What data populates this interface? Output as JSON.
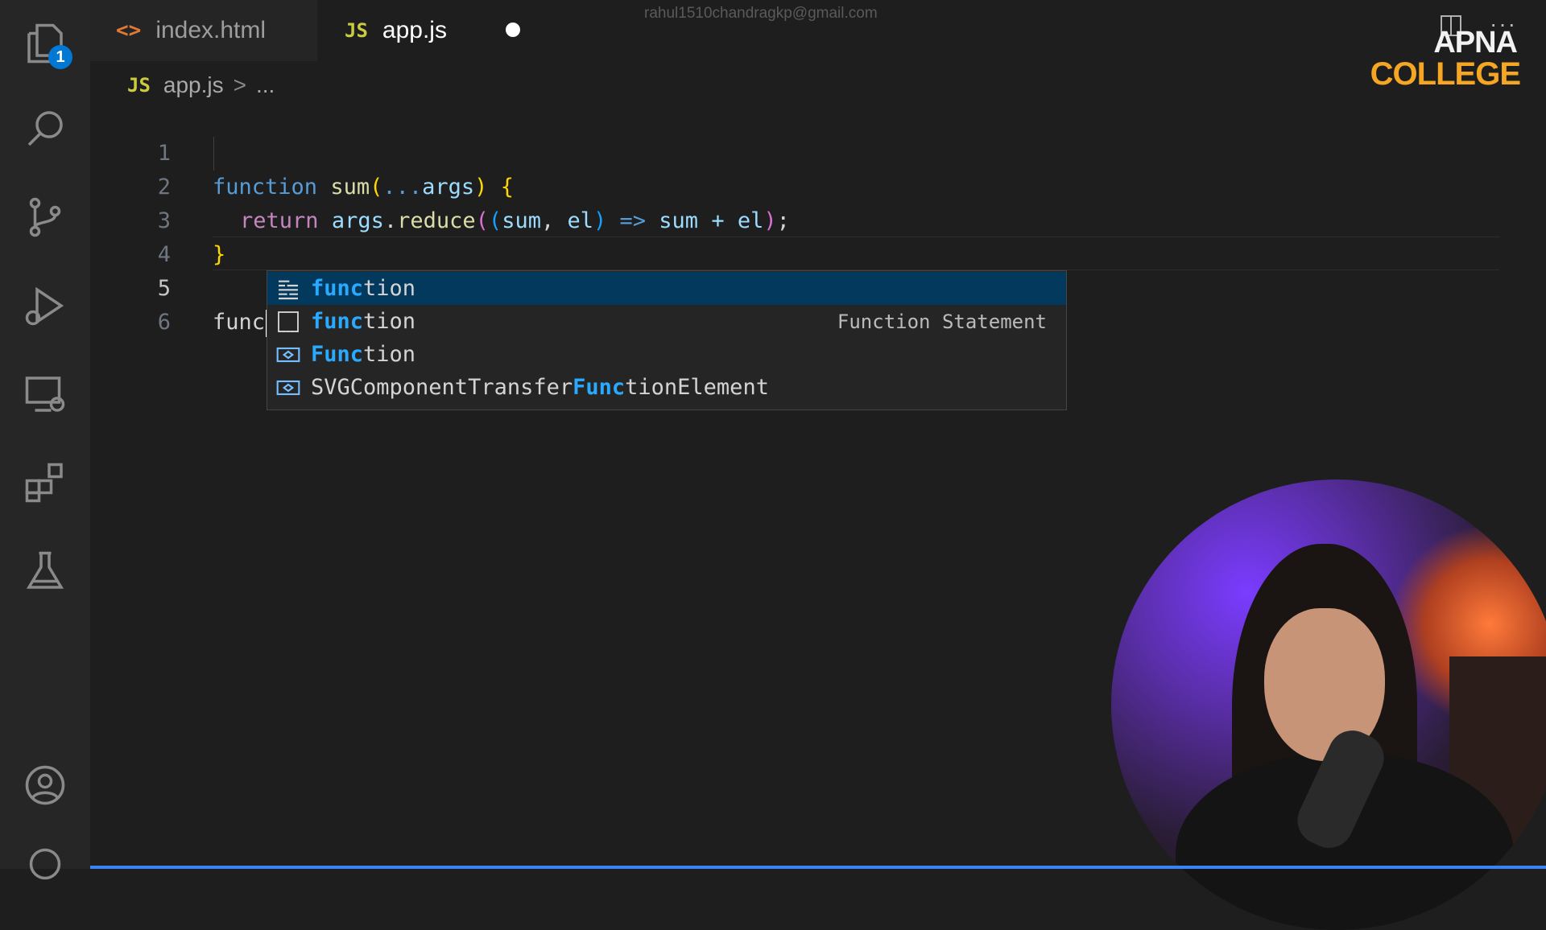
{
  "email": "rahul1510chandragkp@gmail.com",
  "logo": {
    "line1": "APNA",
    "line2": "COLLEGE"
  },
  "activity_bar": {
    "explorer_badge": "1"
  },
  "tabs": [
    {
      "icon": "<>",
      "label": "index.html"
    },
    {
      "icon": "JS",
      "label": "app.js"
    }
  ],
  "breadcrumb": {
    "icon": "JS",
    "file": "app.js",
    "sep": ">",
    "rest": "..."
  },
  "editor": {
    "line_numbers": [
      "1",
      "2",
      "3",
      "4",
      "5",
      "6"
    ],
    "l1": {
      "kw": "function",
      "name": "sum",
      "open": "(",
      "spread": "...",
      "param": "args",
      "close": ")",
      "brace": "{"
    },
    "l2": {
      "kw": "return",
      "obj": "args",
      "dot": ".",
      "method": "reduce",
      "p1": "(",
      "p2": "(",
      "a": "sum",
      "comma": ", ",
      "b": "el",
      "p3": ")",
      "arrow": " => ",
      "expr": "sum + el",
      "p4": ")",
      "semi": ";"
    },
    "l3": {
      "brace": "}"
    },
    "l5": {
      "typed": "func"
    }
  },
  "suggestions": [
    {
      "icon": "snippet-icon",
      "match": "func",
      "rest": "tion",
      "detail": ""
    },
    {
      "icon": "keyword-snippet-icon",
      "match": "func",
      "rest": "tion",
      "detail": "Function Statement"
    },
    {
      "icon": "variable-icon",
      "match": "Func",
      "rest": "tion",
      "detail": ""
    },
    {
      "icon": "variable-icon",
      "pre": "SVGComponentTransfer",
      "match": "Func",
      "rest": "tionElement",
      "detail": ""
    }
  ]
}
